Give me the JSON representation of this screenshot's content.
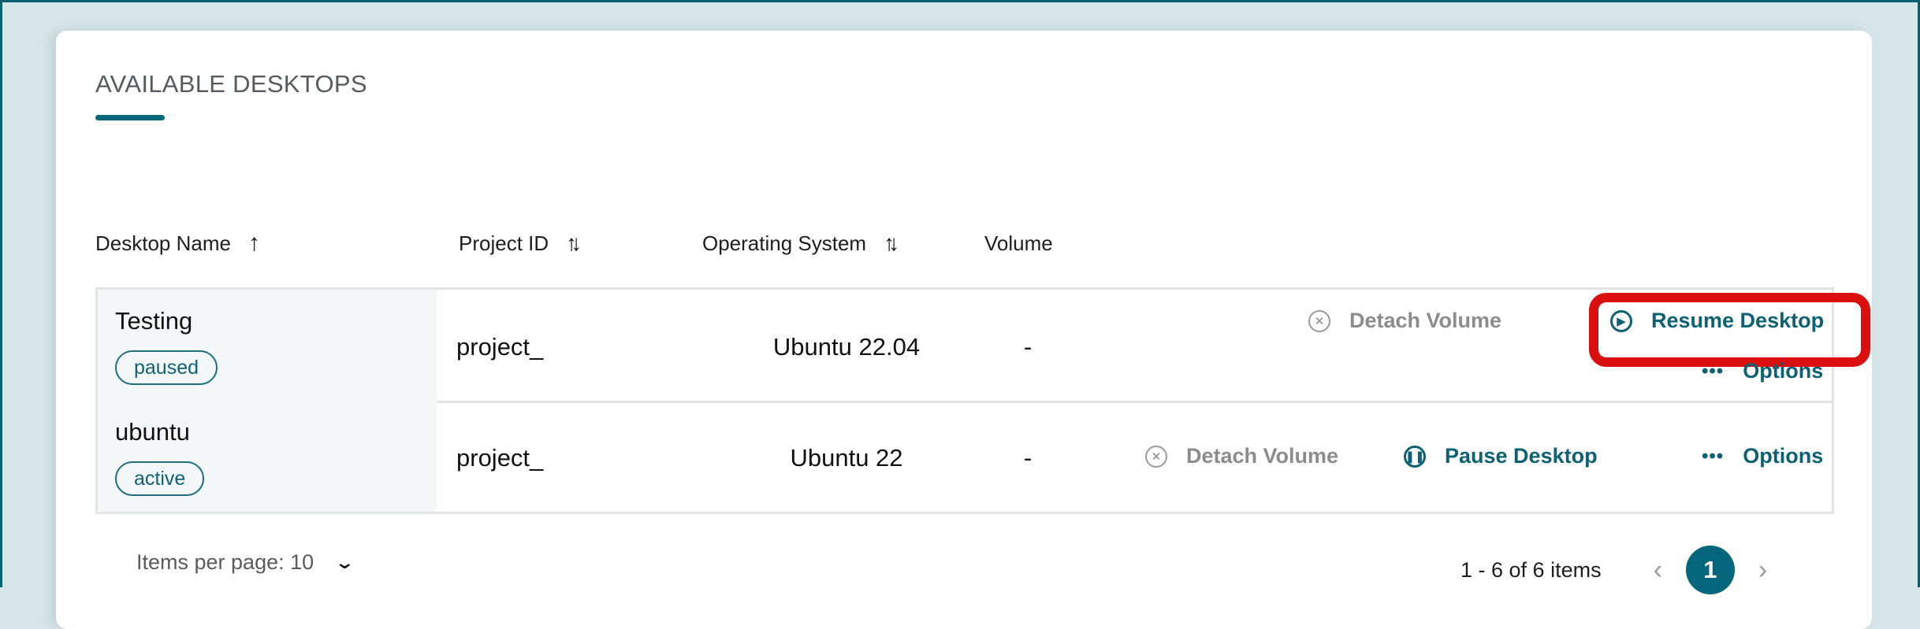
{
  "section": {
    "title": "AVAILABLE DESKTOPS"
  },
  "columns": [
    {
      "label": "Desktop Name",
      "sort": "ascending",
      "sort_icon": "arrow-up-icon"
    },
    {
      "label": "Project ID",
      "sort": "none",
      "sort_icon": "sort-both-icon"
    },
    {
      "label": "Operating System",
      "sort": "none",
      "sort_icon": "sort-both-icon"
    },
    {
      "label": "Volume"
    }
  ],
  "rows": [
    {
      "name": "Testing",
      "status": "paused",
      "project": "project_",
      "os": "Ubuntu 22.04",
      "volume": "-",
      "actions": {
        "detach": "Detach Volume",
        "primary": "Resume Desktop",
        "primary_icon": "play-circle-icon",
        "options": "Options"
      },
      "highlighted_action": "Resume Desktop"
    },
    {
      "name": "ubuntu",
      "status": "active",
      "project": "project_",
      "os": "Ubuntu 22",
      "volume": "-",
      "actions": {
        "detach": "Detach Volume",
        "primary": "Pause Desktop",
        "primary_icon": "pause-circle-icon",
        "options": "Options"
      }
    }
  ],
  "pagination": {
    "items_per_page_label": "Items per page: 10",
    "range_text": "1 - 6 of 6 items",
    "current_page": "1"
  },
  "colors": {
    "accent": "#03667a",
    "highlight": "#d90f10",
    "page_bg": "#d6e6e8"
  }
}
